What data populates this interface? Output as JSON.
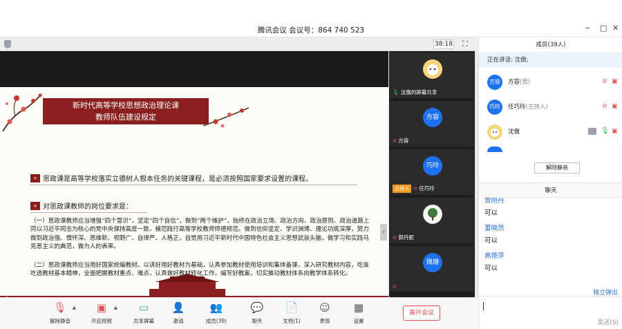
{
  "window": {
    "title": "腾讯会议 会议号：864 740 523",
    "min": "–",
    "max": "□",
    "close": "✕"
  },
  "stage": {
    "timer": "38:18"
  },
  "slide": {
    "title_line1": "新时代高等学校思想政治理论课",
    "title_line2": "教师队伍建设规定",
    "heading1": "思政课是高等学校落实立德树人根本任务的关键课程，是必须按照国家要求设置的课程。",
    "heading2": "对思政课教师的岗位要求是：",
    "para1": "（一）思政课教师应当增强“四个意识”，坚定“四个自信”，做到“两个维护”，始终在政治立场、政治方向、政治原则、政治道路上同以习近平同志为核心的党中央保持高度一致，模范践行高等学校教师师德规范。做到信仰坚定、学识渊博、理论功底深厚，努力做到政治强、情怀深、思维新、视野广、自律严、人格正，自觉用习近平新时代中国特色社会主义思想武装头脑，做学习和实践马克思主义的典范，做为人的表率。",
    "para2": "（二）思政课教师应当用好国家统编教材。以讲好用好教材为基础，认真参加教材使用培训和集体备课，深入研究教材内容，吃准吃透教材基本精神，全面把握教材重点、难点，认真做好教材转化工作，编写好教案，切实推动教材体系向教学体系转化。"
  },
  "thumbs": [
    {
      "name": "沈傲的屏幕共享",
      "avatar": "",
      "muted": false,
      "host": false
    },
    {
      "name": "方容",
      "avatar": "方容",
      "muted": true,
      "host": false
    },
    {
      "name": "任巧玲",
      "avatar": "巧玲",
      "muted": true,
      "host": true,
      "host_label": "主持人"
    },
    {
      "name": "郭丹妮",
      "avatar": "",
      "muted": true,
      "host": false
    },
    {
      "name": "",
      "avatar": "佩珊",
      "muted": true,
      "host": false
    }
  ],
  "toolbar": {
    "unmute": "解除静音",
    "video": "开启视频",
    "share": "共享屏幕",
    "invite": "邀请",
    "members": "成员(39)",
    "chat": "聊天",
    "docs": "文档(1)",
    "emoji": "表情",
    "settings": "设置",
    "leave": "离开会议"
  },
  "members": {
    "header": "成员(39人)",
    "speaking": "正在讲话: 沈傲;",
    "list": [
      {
        "avatar": "方容",
        "name": "方容",
        "role": "(我)"
      },
      {
        "avatar": "巧玲",
        "name": "任巧玲",
        "role": "(主持人)"
      },
      {
        "avatar": "",
        "name": "沈傲",
        "role": ""
      }
    ],
    "unmute_all": "解除静音"
  },
  "chat": {
    "header": "聊天",
    "messages": [
      {
        "name": "曾刚丹",
        "text": "可以"
      },
      {
        "name": "董晓然",
        "text": "可以"
      },
      {
        "name": "高艳萍",
        "text": "可以"
      }
    ],
    "popout": "独立弹出",
    "send": "发送(S)"
  },
  "colors": {
    "brand_red": "#8b1e1e",
    "accent_blue": "#1d72f2",
    "leave_red": "#e24c4c"
  }
}
